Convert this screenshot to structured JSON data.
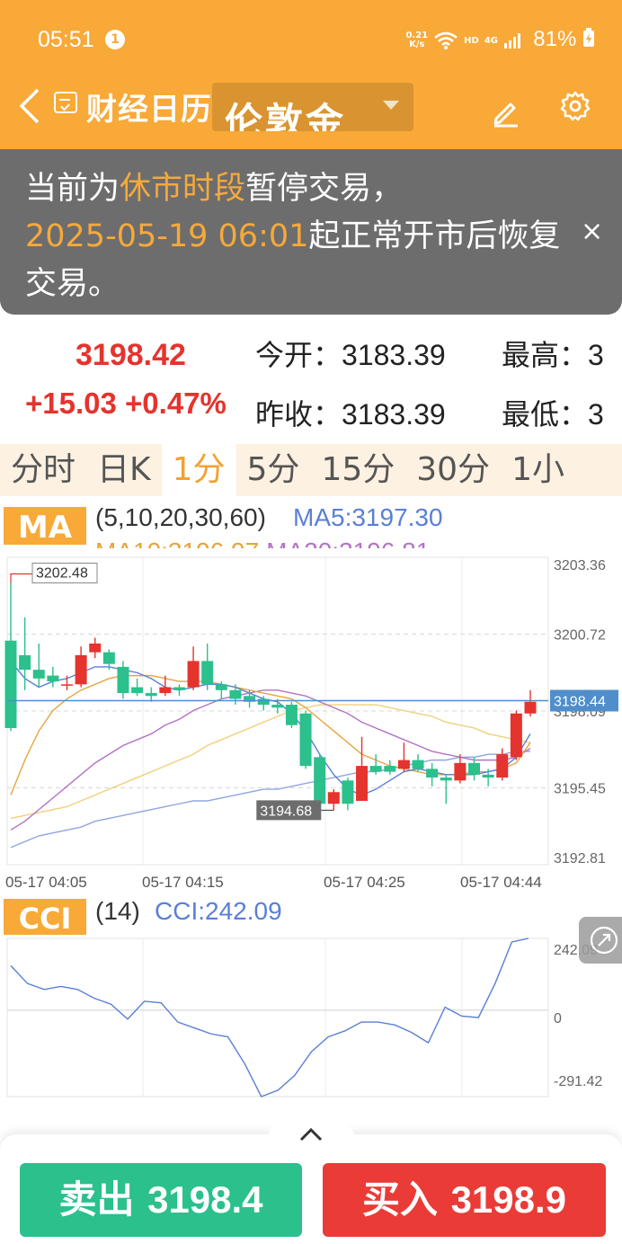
{
  "status_bar": {
    "time": "05:51",
    "notification_count": "1",
    "net_speed_value": "0.21",
    "net_speed_unit": "K/s",
    "hd_label": "HD",
    "network_label": "4G",
    "battery": "81%"
  },
  "header": {
    "title": "财经日历",
    "symbol": "伦敦金"
  },
  "notice": {
    "prefix": "当前为",
    "period": "休市时段",
    "middle": "暂停交易，",
    "datetime": "2025-05-19 06:01",
    "suffix": "起正常开市后恢复交易。",
    "close_glyph": "×"
  },
  "quote": {
    "last_price": "3198.42",
    "change": "+15.03",
    "change_pct": "+0.47%",
    "open_label": "今开：",
    "open_value": "3183.39",
    "high_label": "最高：",
    "high_value": "3",
    "prev_close_label": "昨收：",
    "prev_close_value": "3183.39",
    "low_label": "最低：",
    "low_value": "3"
  },
  "period_tabs": [
    {
      "label": "分时",
      "active": false
    },
    {
      "label": "日K",
      "active": false
    },
    {
      "label": "1分",
      "active": true
    },
    {
      "label": "5分",
      "active": false
    },
    {
      "label": "15分",
      "active": false
    },
    {
      "label": "30分",
      "active": false
    },
    {
      "label": "1小",
      "active": false
    }
  ],
  "ma_legend": {
    "tag": "MA",
    "params": "(5,10,20,30,60)",
    "ma5": "MA5:3197.30",
    "ma10": "MA10:3196.97",
    "ma20": "MA20:3196.81"
  },
  "cci_legend": {
    "tag": "CCI",
    "param": "(14)",
    "value": "CCI:242.09"
  },
  "chart_data": [
    {
      "type": "candlestick",
      "interval": "1分",
      "y_ticks": [
        "3203.36",
        "3200.72",
        "3198.09",
        "3195.45",
        "3192.81"
      ],
      "ylim": [
        3192.81,
        3203.36
      ],
      "x_ticks": [
        "05-17 04:05",
        "05-17 04:15",
        "05-17 04:25",
        "05-17 04:44"
      ],
      "current_price": "3198.44",
      "max_annotation": {
        "label": "3202.48",
        "value": 3202.48,
        "index": 0
      },
      "min_annotation": {
        "label": "3194.68",
        "value": 3194.68,
        "index": 23
      },
      "colors": {
        "up": "#e5332d",
        "down": "#2bc08c",
        "ma5": "#5a7fd6",
        "ma10": "#e6a43c",
        "ma20": "#b472c6",
        "ma30": "#f0d07a",
        "ma60": "#8fa6e0"
      },
      "candles": [
        [
          3200.5,
          3197.5,
          3202.48,
          3197.4
        ],
        [
          3200.0,
          3199.5,
          3201.3,
          3198.8
        ],
        [
          3199.5,
          3199.2,
          3200.4,
          3198.9
        ],
        [
          3199.3,
          3199.1,
          3199.6,
          3198.9
        ],
        [
          3199.0,
          3199.0,
          3199.3,
          3198.8
        ],
        [
          3199.0,
          3200.0,
          3200.3,
          3198.9
        ],
        [
          3200.1,
          3200.4,
          3200.6,
          3199.9
        ],
        [
          3200.1,
          3199.7,
          3200.2,
          3199.5
        ],
        [
          3199.6,
          3198.7,
          3199.8,
          3198.5
        ],
        [
          3198.9,
          3198.7,
          3199.2,
          3198.6
        ],
        [
          3198.7,
          3198.6,
          3198.9,
          3198.4
        ],
        [
          3198.7,
          3198.9,
          3199.3,
          3198.6
        ],
        [
          3198.9,
          3198.8,
          3199.0,
          3198.6
        ],
        [
          3198.9,
          3199.8,
          3200.3,
          3198.8
        ],
        [
          3199.8,
          3199.0,
          3200.4,
          3198.8
        ],
        [
          3199.0,
          3198.8,
          3199.1,
          3198.5
        ],
        [
          3198.8,
          3198.5,
          3199.0,
          3198.3
        ],
        [
          3198.6,
          3198.4,
          3198.8,
          3198.2
        ],
        [
          3198.5,
          3198.3,
          3198.6,
          3198.1
        ],
        [
          3198.3,
          3198.2,
          3198.5,
          3198.0
        ],
        [
          3198.3,
          3197.6,
          3198.4,
          3197.5
        ],
        [
          3198.0,
          3196.2,
          3198.1,
          3196.1
        ],
        [
          3196.5,
          3194.9,
          3196.6,
          3194.8
        ],
        [
          3194.9,
          3195.3,
          3195.4,
          3194.68
        ],
        [
          3195.7,
          3194.9,
          3195.8,
          3194.68
        ],
        [
          3195.0,
          3196.2,
          3197.2,
          3195.0
        ],
        [
          3196.2,
          3196.0,
          3196.6,
          3195.9
        ],
        [
          3196.2,
          3196.0,
          3196.4,
          3195.9
        ],
        [
          3196.1,
          3196.4,
          3197.0,
          3196.0
        ],
        [
          3196.4,
          3196.1,
          3196.6,
          3196.0
        ],
        [
          3196.1,
          3195.8,
          3196.3,
          3195.5
        ],
        [
          3195.8,
          3195.7,
          3195.9,
          3194.9
        ],
        [
          3195.7,
          3196.3,
          3196.6,
          3195.6
        ],
        [
          3196.3,
          3195.9,
          3196.5,
          3195.7
        ],
        [
          3195.9,
          3195.8,
          3196.1,
          3195.5
        ],
        [
          3195.8,
          3196.6,
          3196.8,
          3195.7
        ],
        [
          3196.5,
          3198.0,
          3198.1,
          3196.4
        ],
        [
          3198.0,
          3198.4,
          3198.8,
          3197.9
        ]
      ],
      "ma5": [
        3199.8,
        3199.2,
        3198.9,
        3199.1,
        3199.2,
        3199.4,
        3199.6,
        3199.6,
        3199.5,
        3199.4,
        3199.2,
        3198.9,
        3198.8,
        3198.9,
        3199.0,
        3199.0,
        3198.9,
        3198.7,
        3198.5,
        3198.4,
        3198.0,
        3197.4,
        3196.6,
        3195.9,
        3195.4,
        3195.2,
        3195.4,
        3195.7,
        3196.0,
        3196.1,
        3196.0,
        3195.9,
        3195.9,
        3195.9,
        3196.0,
        3196.1,
        3196.5,
        3197.3
      ],
      "ma10": [
        3195.2,
        3196.4,
        3197.4,
        3198.1,
        3198.5,
        3198.8,
        3199.0,
        3199.2,
        3199.3,
        3199.3,
        3199.3,
        3199.2,
        3199.1,
        3199.1,
        3199.1,
        3199.0,
        3198.9,
        3198.8,
        3198.7,
        3198.6,
        3198.5,
        3198.2,
        3197.8,
        3197.4,
        3197.0,
        3196.6,
        3196.4,
        3196.2,
        3196.1,
        3196.0,
        3195.9,
        3195.9,
        3195.9,
        3196.0,
        3196.0,
        3196.1,
        3196.3,
        3197.0
      ],
      "ma20": [
        3194.0,
        3194.3,
        3194.7,
        3195.1,
        3195.5,
        3195.9,
        3196.3,
        3196.6,
        3196.9,
        3197.1,
        3197.3,
        3197.6,
        3197.8,
        3198.1,
        3198.3,
        3198.5,
        3198.6,
        3198.7,
        3198.8,
        3198.8,
        3198.7,
        3198.6,
        3198.4,
        3198.2,
        3198.0,
        3197.7,
        3197.5,
        3197.3,
        3197.1,
        3196.9,
        3196.7,
        3196.6,
        3196.5,
        3196.4,
        3196.4,
        3196.4,
        3196.5,
        3196.8
      ],
      "ma30": [
        3194.4,
        3194.5,
        3194.6,
        3194.7,
        3194.8,
        3195.0,
        3195.2,
        3195.4,
        3195.6,
        3195.8,
        3196.0,
        3196.2,
        3196.4,
        3196.6,
        3196.9,
        3197.1,
        3197.3,
        3197.5,
        3197.7,
        3197.9,
        3198.1,
        3198.2,
        3198.3,
        3198.3,
        3198.3,
        3198.3,
        3198.3,
        3198.2,
        3198.1,
        3198.0,
        3197.9,
        3197.7,
        3197.6,
        3197.5,
        3197.3,
        3197.2,
        3197.1,
        3197.0
      ],
      "ma60": [
        3193.4,
        3193.6,
        3193.8,
        3193.9,
        3194.0,
        3194.1,
        3194.3,
        3194.4,
        3194.5,
        3194.6,
        3194.7,
        3194.8,
        3194.9,
        3195.0,
        3195.0,
        3195.1,
        3195.2,
        3195.3,
        3195.4,
        3195.4,
        3195.5,
        3195.6,
        3195.7,
        3195.8,
        3195.9,
        3196.0,
        3196.0,
        3196.1,
        3196.2,
        3196.3,
        3196.4,
        3196.4,
        3196.5,
        3196.5,
        3196.6,
        3196.6,
        3196.7,
        3196.7
      ]
    },
    {
      "type": "line",
      "indicator": "CCI",
      "y_ticks": [
        "242.09",
        "0",
        "-291.42"
      ],
      "ylim": [
        -291.42,
        242.09
      ],
      "values": [
        150,
        90,
        70,
        80,
        70,
        40,
        20,
        -30,
        30,
        25,
        -40,
        -60,
        -80,
        -90,
        -180,
        -291.42,
        -270,
        -220,
        -140,
        -90,
        -70,
        -40,
        -40,
        -50,
        -75,
        -110,
        10,
        -20,
        -25,
        90,
        230,
        242.09
      ]
    }
  ],
  "trade": {
    "sell_label": "卖出",
    "sell_price": "3198.4",
    "buy_label": "买入",
    "buy_price": "3198.9"
  }
}
